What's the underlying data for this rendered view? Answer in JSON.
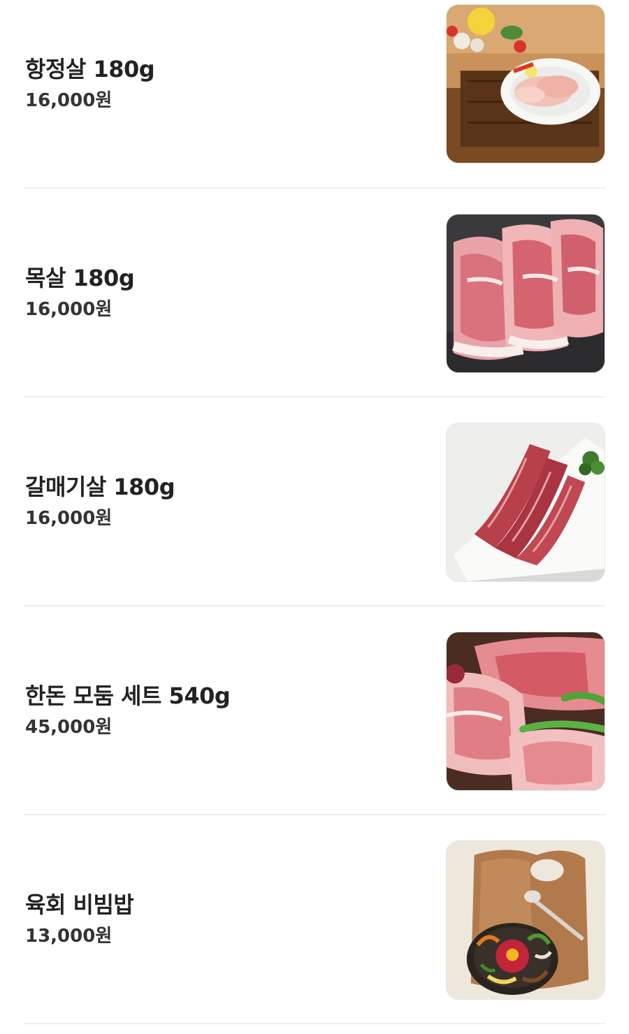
{
  "menu": {
    "items": [
      {
        "name": "항정살 180g",
        "price": "16,000원",
        "image": "pork-jowl-plate-photo"
      },
      {
        "name": "목살 180g",
        "price": "16,000원",
        "image": "pork-neck-slices-photo"
      },
      {
        "name": "갈매기살 180g",
        "price": "16,000원",
        "image": "pork-skirt-plate-photo"
      },
      {
        "name": "한돈 모둠 세트 540g",
        "price": "45,000원",
        "image": "assorted-pork-set-photo"
      },
      {
        "name": "육회 비빔밥",
        "price": "13,000원",
        "image": "yukhoe-bibimbap-photo"
      }
    ]
  }
}
